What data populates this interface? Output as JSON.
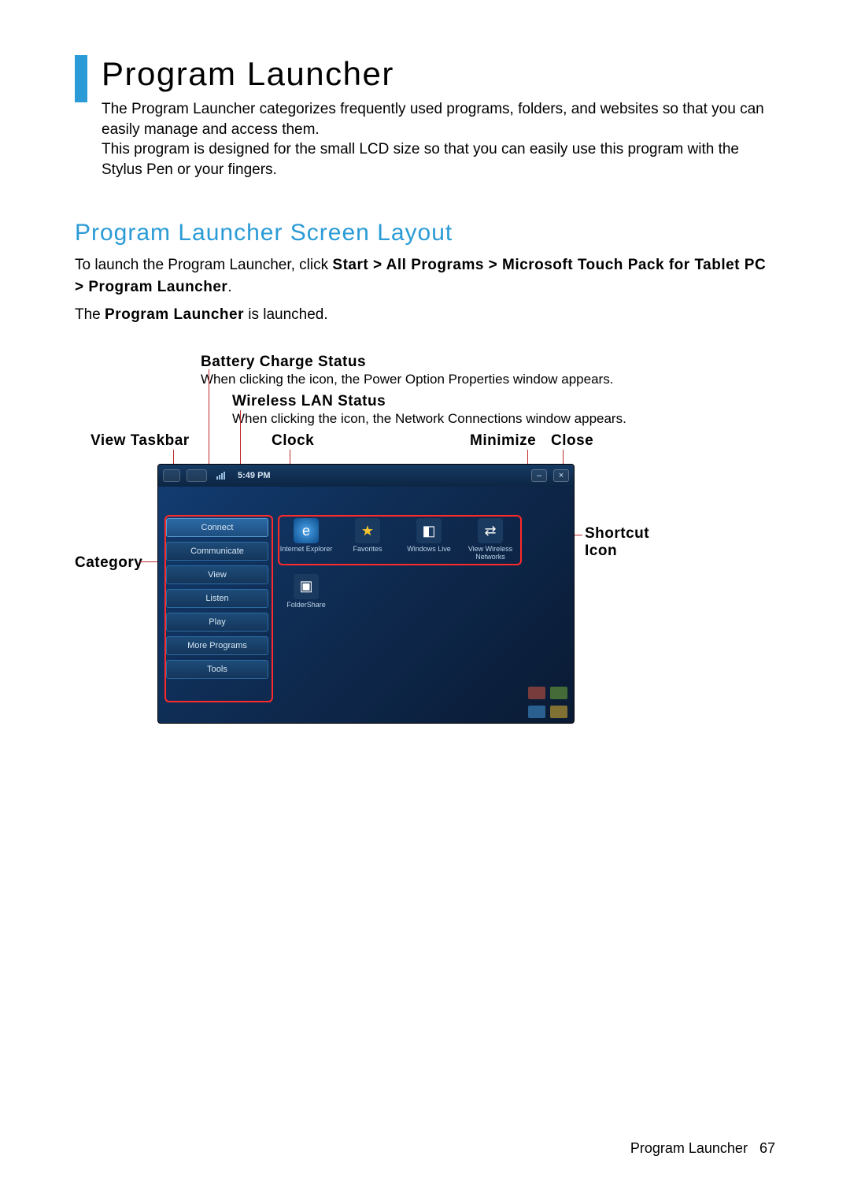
{
  "page": {
    "title": "Program Launcher",
    "intro1": "The Program Launcher categorizes frequently used programs, folders, and websites  so that you can easily manage and access them.",
    "intro2": "This program is designed for the small LCD size so that you can easily use this program with the Stylus Pen or your fingers.",
    "subtitle": "Program Launcher Screen Layout",
    "launch_prefix": "To launch the Program Launcher, click ",
    "launch_path": "Start > All Programs > Microsoft Touch Pack for Tablet PC > Program Launcher",
    "launch_suffix": ".",
    "launched_prefix": "The ",
    "launched_bold": "Program Launcher",
    "launched_suffix": " is launched."
  },
  "annotations": {
    "battery_title": "Battery Charge Status",
    "battery_desc": "When clicking the icon, the Power Option Properties window appears.",
    "wlan_title": "Wireless LAN Status",
    "wlan_desc": "When clicking the icon, the Network Connections window appears.",
    "view_taskbar": "View Taskbar",
    "clock": "Clock",
    "minimize": "Minimize",
    "close": "Close",
    "category": "Category",
    "shortcut_icon": "Shortcut Icon"
  },
  "launcher": {
    "clock_time": "5:49 PM",
    "categories": [
      "Connect",
      "Communicate",
      "View",
      "Listen",
      "Play",
      "More Programs",
      "Tools"
    ],
    "apps_row1": [
      "Internet Explorer",
      "Favorites",
      "Windows Live",
      "View Wireless Networks"
    ],
    "apps_row2": [
      "FolderShare"
    ]
  },
  "footer": {
    "label": "Program Launcher",
    "page_num": "67"
  }
}
